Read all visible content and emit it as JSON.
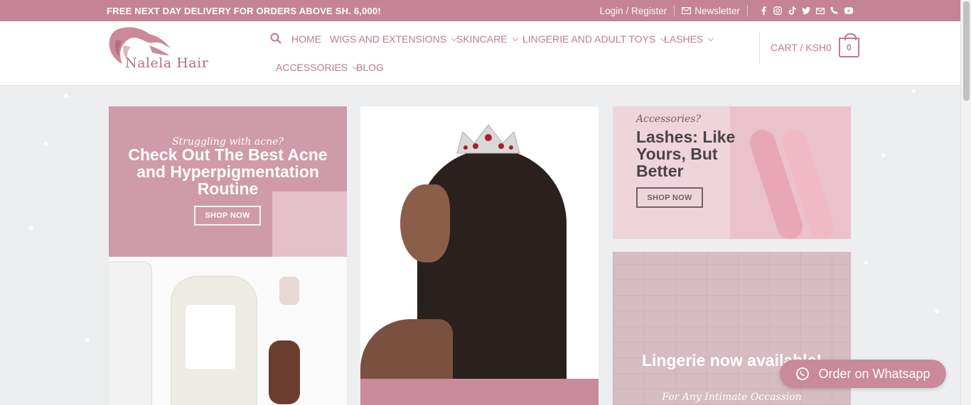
{
  "topbar": {
    "promo": "FREE NEXT DAY DELIVERY FOR ORDERS ABOVE SH. 6,000!",
    "login": "Login / Register",
    "newsletter": "Newsletter",
    "social_icons": [
      "facebook-icon",
      "instagram-icon",
      "tiktok-icon",
      "twitter-icon",
      "email-icon",
      "phone-icon",
      "youtube-icon"
    ]
  },
  "header": {
    "logo_text": "Nalela Hair",
    "nav": {
      "home": "HOME",
      "wigs": "WIGS AND EXTENSIONS",
      "skincare": "SKINCARE",
      "lingerie": "LINGERIE AND ADULT TOYS",
      "lashes": "LASHES",
      "accessories": "ACCESSORIES",
      "blog": "BLOG"
    },
    "cart_label": "CART / KSH0",
    "cart_count": "0"
  },
  "banners": {
    "acne": {
      "kicker": "Struggling with acne?",
      "title": "Check Out The Best Acne and Hyperpigmentation Routine",
      "button": "SHOP NOW"
    },
    "lashes": {
      "kicker": "Accessories?",
      "title": "Lashes: Like Yours, But Better",
      "button": "SHOP NOW"
    },
    "lingerie": {
      "title": "Lingerie now available!",
      "subtitle": "For Any Intimate Occassion"
    }
  },
  "whatsapp": {
    "label": "Order on Whatsapp"
  },
  "colors": {
    "accent": "#c58496",
    "link": "#c07a8d"
  }
}
